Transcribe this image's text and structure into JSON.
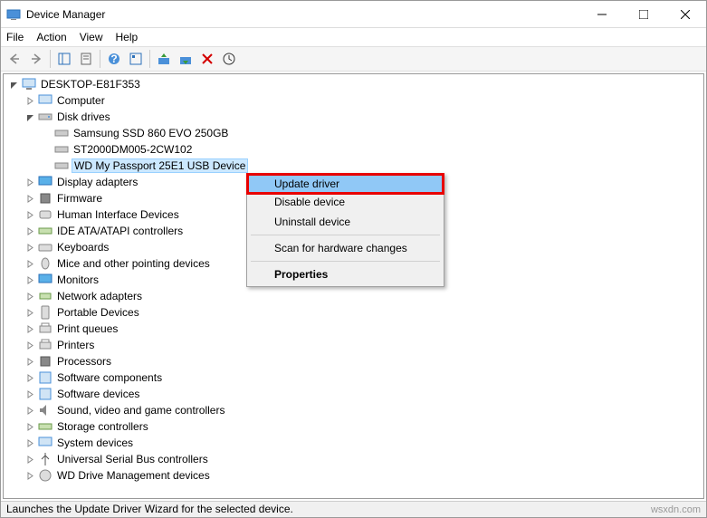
{
  "window": {
    "title": "Device Manager"
  },
  "menu": {
    "file": "File",
    "action": "Action",
    "view": "View",
    "help": "Help"
  },
  "tree": {
    "root": "DESKTOP-E81F353",
    "computer": "Computer",
    "diskdrives": "Disk drives",
    "dd1": "Samsung SSD 860 EVO 250GB",
    "dd2": "ST2000DM005-2CW102",
    "dd3": "WD My Passport 25E1 USB Device",
    "display": "Display adapters",
    "firmware": "Firmware",
    "hid": "Human Interface Devices",
    "ide": "IDE ATA/ATAPI controllers",
    "keyboards": "Keyboards",
    "mice": "Mice and other pointing devices",
    "monitors": "Monitors",
    "network": "Network adapters",
    "portable": "Portable Devices",
    "printq": "Print queues",
    "printers": "Printers",
    "processors": "Processors",
    "swcomp": "Software components",
    "swdev": "Software devices",
    "sound": "Sound, video and game controllers",
    "storage": "Storage controllers",
    "sysdev": "System devices",
    "usb": "Universal Serial Bus controllers",
    "wddrive": "WD Drive Management devices"
  },
  "context": {
    "update": "Update driver",
    "disable": "Disable device",
    "uninstall": "Uninstall device",
    "scan": "Scan for hardware changes",
    "properties": "Properties"
  },
  "status": "Launches the Update Driver Wizard for the selected device.",
  "watermark": "wsxdn.com"
}
